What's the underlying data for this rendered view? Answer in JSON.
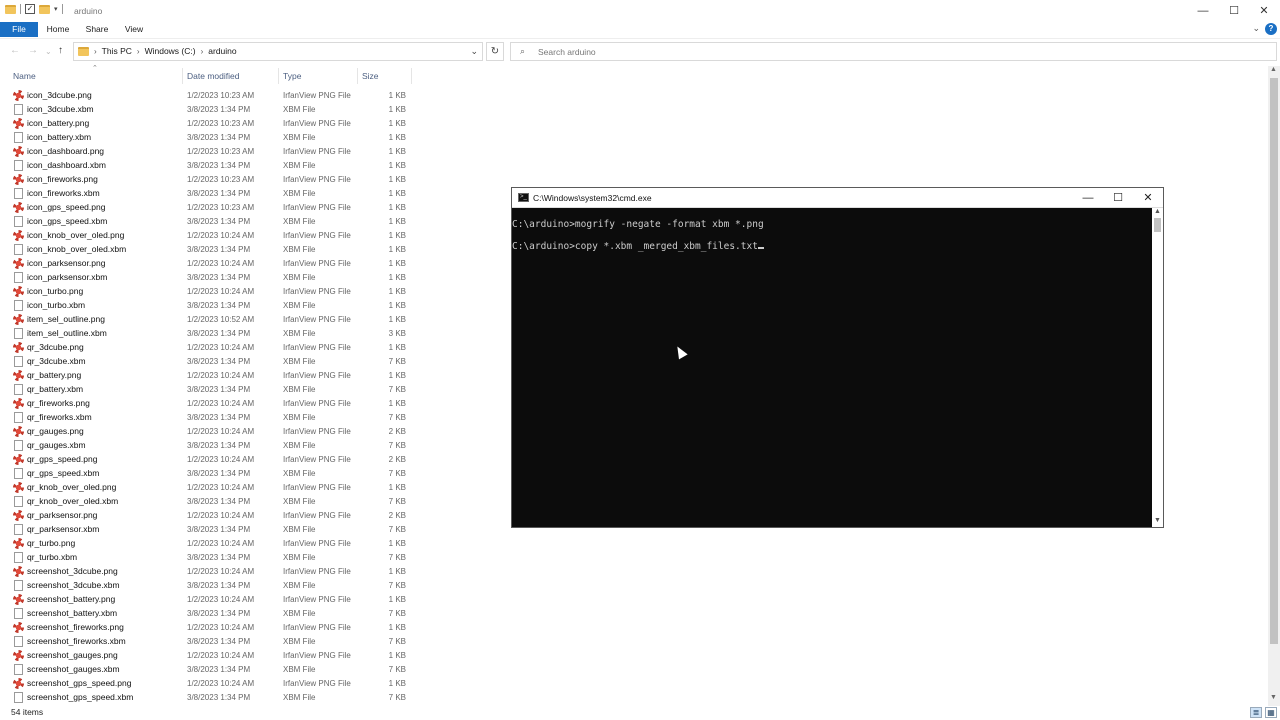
{
  "window": {
    "title": "arduino",
    "controls": {
      "minimize": "—",
      "maximize": "☐",
      "close": "✕"
    }
  },
  "ribbon": {
    "tabs": [
      "File",
      "Home",
      "Share",
      "View"
    ],
    "help": "?"
  },
  "address": {
    "crumbs": [
      "This PC",
      "Windows (C:)",
      "arduino"
    ]
  },
  "search": {
    "placeholder": "Search arduino"
  },
  "columns": {
    "name": "Name",
    "date": "Date modified",
    "type": "Type",
    "size": "Size"
  },
  "files": [
    {
      "name": "icon_3dcube.png",
      "date": "1/2/2023 10:23 AM",
      "type": "IrfanView PNG File",
      "size": "1 KB",
      "kind": "png"
    },
    {
      "name": "icon_3dcube.xbm",
      "date": "3/8/2023 1:34 PM",
      "type": "XBM File",
      "size": "1 KB",
      "kind": "xbm"
    },
    {
      "name": "icon_battery.png",
      "date": "1/2/2023 10:23 AM",
      "type": "IrfanView PNG File",
      "size": "1 KB",
      "kind": "png"
    },
    {
      "name": "icon_battery.xbm",
      "date": "3/8/2023 1:34 PM",
      "type": "XBM File",
      "size": "1 KB",
      "kind": "xbm"
    },
    {
      "name": "icon_dashboard.png",
      "date": "1/2/2023 10:23 AM",
      "type": "IrfanView PNG File",
      "size": "1 KB",
      "kind": "png"
    },
    {
      "name": "icon_dashboard.xbm",
      "date": "3/8/2023 1:34 PM",
      "type": "XBM File",
      "size": "1 KB",
      "kind": "xbm"
    },
    {
      "name": "icon_fireworks.png",
      "date": "1/2/2023 10:23 AM",
      "type": "IrfanView PNG File",
      "size": "1 KB",
      "kind": "png"
    },
    {
      "name": "icon_fireworks.xbm",
      "date": "3/8/2023 1:34 PM",
      "type": "XBM File",
      "size": "1 KB",
      "kind": "xbm"
    },
    {
      "name": "icon_gps_speed.png",
      "date": "1/2/2023 10:23 AM",
      "type": "IrfanView PNG File",
      "size": "1 KB",
      "kind": "png"
    },
    {
      "name": "icon_gps_speed.xbm",
      "date": "3/8/2023 1:34 PM",
      "type": "XBM File",
      "size": "1 KB",
      "kind": "xbm"
    },
    {
      "name": "icon_knob_over_oled.png",
      "date": "1/2/2023 10:24 AM",
      "type": "IrfanView PNG File",
      "size": "1 KB",
      "kind": "png"
    },
    {
      "name": "icon_knob_over_oled.xbm",
      "date": "3/8/2023 1:34 PM",
      "type": "XBM File",
      "size": "1 KB",
      "kind": "xbm"
    },
    {
      "name": "icon_parksensor.png",
      "date": "1/2/2023 10:24 AM",
      "type": "IrfanView PNG File",
      "size": "1 KB",
      "kind": "png"
    },
    {
      "name": "icon_parksensor.xbm",
      "date": "3/8/2023 1:34 PM",
      "type": "XBM File",
      "size": "1 KB",
      "kind": "xbm"
    },
    {
      "name": "icon_turbo.png",
      "date": "1/2/2023 10:24 AM",
      "type": "IrfanView PNG File",
      "size": "1 KB",
      "kind": "png"
    },
    {
      "name": "icon_turbo.xbm",
      "date": "3/8/2023 1:34 PM",
      "type": "XBM File",
      "size": "1 KB",
      "kind": "xbm"
    },
    {
      "name": "item_sel_outline.png",
      "date": "1/2/2023 10:52 AM",
      "type": "IrfanView PNG File",
      "size": "1 KB",
      "kind": "png"
    },
    {
      "name": "item_sel_outline.xbm",
      "date": "3/8/2023 1:34 PM",
      "type": "XBM File",
      "size": "3 KB",
      "kind": "xbm"
    },
    {
      "name": "qr_3dcube.png",
      "date": "1/2/2023 10:24 AM",
      "type": "IrfanView PNG File",
      "size": "1 KB",
      "kind": "png"
    },
    {
      "name": "qr_3dcube.xbm",
      "date": "3/8/2023 1:34 PM",
      "type": "XBM File",
      "size": "7 KB",
      "kind": "xbm"
    },
    {
      "name": "qr_battery.png",
      "date": "1/2/2023 10:24 AM",
      "type": "IrfanView PNG File",
      "size": "1 KB",
      "kind": "png"
    },
    {
      "name": "qr_battery.xbm",
      "date": "3/8/2023 1:34 PM",
      "type": "XBM File",
      "size": "7 KB",
      "kind": "xbm"
    },
    {
      "name": "qr_fireworks.png",
      "date": "1/2/2023 10:24 AM",
      "type": "IrfanView PNG File",
      "size": "1 KB",
      "kind": "png"
    },
    {
      "name": "qr_fireworks.xbm",
      "date": "3/8/2023 1:34 PM",
      "type": "XBM File",
      "size": "7 KB",
      "kind": "xbm"
    },
    {
      "name": "qr_gauges.png",
      "date": "1/2/2023 10:24 AM",
      "type": "IrfanView PNG File",
      "size": "2 KB",
      "kind": "png"
    },
    {
      "name": "qr_gauges.xbm",
      "date": "3/8/2023 1:34 PM",
      "type": "XBM File",
      "size": "7 KB",
      "kind": "xbm"
    },
    {
      "name": "qr_gps_speed.png",
      "date": "1/2/2023 10:24 AM",
      "type": "IrfanView PNG File",
      "size": "2 KB",
      "kind": "png"
    },
    {
      "name": "qr_gps_speed.xbm",
      "date": "3/8/2023 1:34 PM",
      "type": "XBM File",
      "size": "7 KB",
      "kind": "xbm"
    },
    {
      "name": "qr_knob_over_oled.png",
      "date": "1/2/2023 10:24 AM",
      "type": "IrfanView PNG File",
      "size": "1 KB",
      "kind": "png"
    },
    {
      "name": "qr_knob_over_oled.xbm",
      "date": "3/8/2023 1:34 PM",
      "type": "XBM File",
      "size": "7 KB",
      "kind": "xbm"
    },
    {
      "name": "qr_parksensor.png",
      "date": "1/2/2023 10:24 AM",
      "type": "IrfanView PNG File",
      "size": "2 KB",
      "kind": "png"
    },
    {
      "name": "qr_parksensor.xbm",
      "date": "3/8/2023 1:34 PM",
      "type": "XBM File",
      "size": "7 KB",
      "kind": "xbm"
    },
    {
      "name": "qr_turbo.png",
      "date": "1/2/2023 10:24 AM",
      "type": "IrfanView PNG File",
      "size": "1 KB",
      "kind": "png"
    },
    {
      "name": "qr_turbo.xbm",
      "date": "3/8/2023 1:34 PM",
      "type": "XBM File",
      "size": "7 KB",
      "kind": "xbm"
    },
    {
      "name": "screenshot_3dcube.png",
      "date": "1/2/2023 10:24 AM",
      "type": "IrfanView PNG File",
      "size": "1 KB",
      "kind": "png"
    },
    {
      "name": "screenshot_3dcube.xbm",
      "date": "3/8/2023 1:34 PM",
      "type": "XBM File",
      "size": "7 KB",
      "kind": "xbm"
    },
    {
      "name": "screenshot_battery.png",
      "date": "1/2/2023 10:24 AM",
      "type": "IrfanView PNG File",
      "size": "1 KB",
      "kind": "png"
    },
    {
      "name": "screenshot_battery.xbm",
      "date": "3/8/2023 1:34 PM",
      "type": "XBM File",
      "size": "7 KB",
      "kind": "xbm"
    },
    {
      "name": "screenshot_fireworks.png",
      "date": "1/2/2023 10:24 AM",
      "type": "IrfanView PNG File",
      "size": "1 KB",
      "kind": "png"
    },
    {
      "name": "screenshot_fireworks.xbm",
      "date": "3/8/2023 1:34 PM",
      "type": "XBM File",
      "size": "7 KB",
      "kind": "xbm"
    },
    {
      "name": "screenshot_gauges.png",
      "date": "1/2/2023 10:24 AM",
      "type": "IrfanView PNG File",
      "size": "1 KB",
      "kind": "png"
    },
    {
      "name": "screenshot_gauges.xbm",
      "date": "3/8/2023 1:34 PM",
      "type": "XBM File",
      "size": "7 KB",
      "kind": "xbm"
    },
    {
      "name": "screenshot_gps_speed.png",
      "date": "1/2/2023 10:24 AM",
      "type": "IrfanView PNG File",
      "size": "1 KB",
      "kind": "png"
    },
    {
      "name": "screenshot_gps_speed.xbm",
      "date": "3/8/2023 1:34 PM",
      "type": "XBM File",
      "size": "7 KB",
      "kind": "xbm"
    }
  ],
  "status": {
    "item_count": "54 items"
  },
  "cmd": {
    "title": "C:\\Windows\\system32\\cmd.exe",
    "lines": [
      "C:\\arduino>mogrify -negate -format xbm *.png",
      "C:\\arduino>copy *.xbm _merged_xbm_files.txt"
    ]
  },
  "colors": {
    "accent": "#1a6fc4",
    "console_bg": "#0c0c0c",
    "console_fg": "#cccccc"
  }
}
